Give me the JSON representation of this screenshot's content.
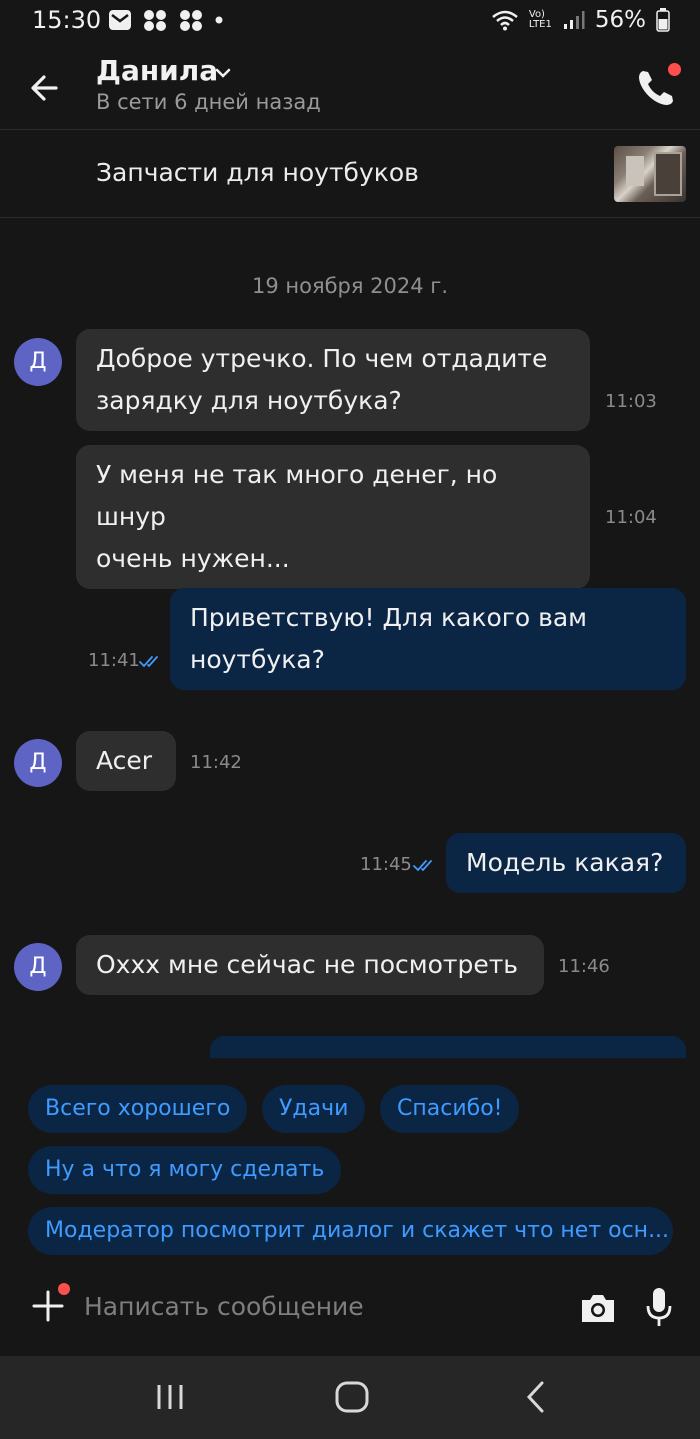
{
  "status_bar": {
    "time": "15:30",
    "battery": "56%",
    "network": "Vo) LTE1"
  },
  "header": {
    "name": "Данила",
    "status": "В сети 6 дней назад"
  },
  "listing": {
    "title": "Запчасти для ноутбуков"
  },
  "chat": {
    "date": "19 ноября 2024 г.",
    "avatar_letter": "Д",
    "messages": [
      {
        "direction": "in",
        "lines": [
          "Доброе утречко. По чем отдадите",
          "зарядку для ноутбука?"
        ],
        "time": "11:03"
      },
      {
        "direction": "in",
        "lines": [
          "У меня не так много денег, но шнур",
          "очень нужен..."
        ],
        "time": "11:04"
      },
      {
        "direction": "out",
        "lines": [
          "Приветствую! Для какого вам",
          "ноутбука?"
        ],
        "time": "11:41"
      },
      {
        "direction": "in",
        "lines": [
          "Acer"
        ],
        "time": "11:42"
      },
      {
        "direction": "out",
        "lines": [
          "Модель какая?"
        ],
        "time": "11:45"
      },
      {
        "direction": "in",
        "lines": [
          "Охxx мне сейчас не посмотреть"
        ],
        "time": "11:46"
      }
    ]
  },
  "quick_replies": [
    "Всего хорошего",
    "Удачи",
    "Спасибо!",
    "Ну а что я могу сделать",
    "Модератор посмотрит диалог и скажет что нет осн..."
  ],
  "composer": {
    "placeholder": "Написать сообщение"
  },
  "icons": {
    "back": "arrow-left-icon",
    "call": "phone-icon",
    "add": "plus-icon",
    "camera": "camera-icon",
    "mic": "microphone-icon",
    "read": "double-check-icon"
  },
  "colors": {
    "background": "#161616",
    "incoming_bubble": "#2e2e2e",
    "outgoing_bubble": "#0b2545",
    "chip_text": "#3f9bff",
    "avatar": "#5d64c4",
    "badge": "#ff4e4e"
  }
}
